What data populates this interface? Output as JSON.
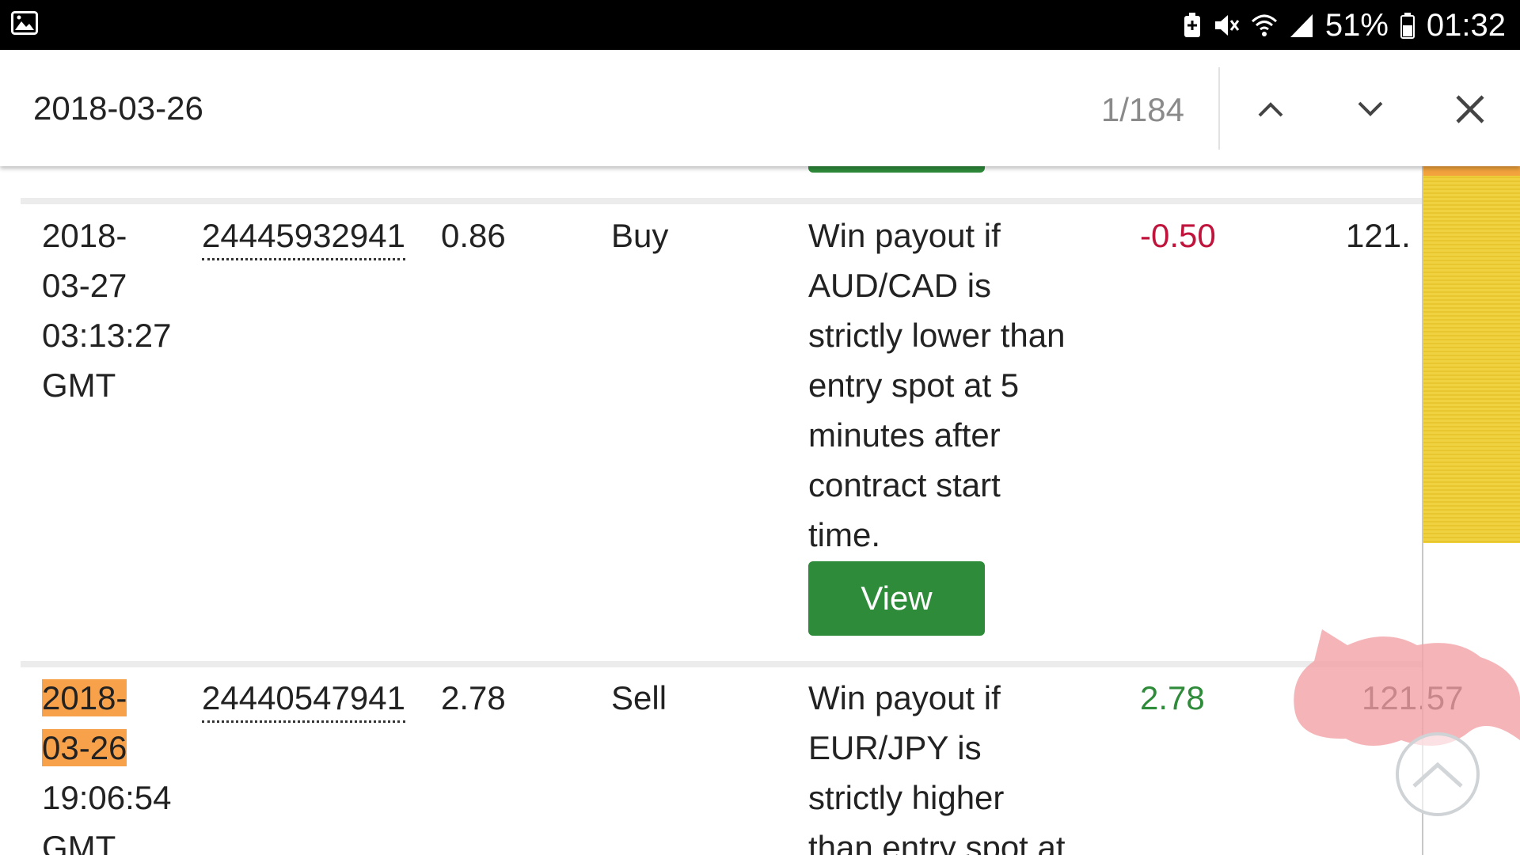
{
  "status_bar": {
    "battery_percent": "51%",
    "time": "01:32",
    "icons": [
      "gallery-icon",
      "battery-saver-icon",
      "mute-icon",
      "wifi-icon",
      "signal-icon",
      "battery-icon"
    ]
  },
  "find_bar": {
    "query": "2018-03-26",
    "match_count": "1/184",
    "prev_icon": "chevron-up-icon",
    "next_icon": "chevron-down-icon",
    "close_icon": "close-icon"
  },
  "rows": [
    {
      "date_lines": [
        "2018-",
        "03-27",
        "03:13:27",
        "GMT"
      ],
      "ref": "24445932941",
      "buy_price": "0.86",
      "type": "Buy",
      "description_lines": [
        "Win payout if",
        "AUD/CAD is",
        "strictly lower than",
        "entry spot at 5",
        "minutes after",
        "contract start",
        "time."
      ],
      "profit": "-0.50",
      "balance": "121.",
      "view_label": "View"
    },
    {
      "date_lines": [
        "2018-",
        "03-26",
        "19:06:54",
        "GMT"
      ],
      "ref": "24440547941",
      "buy_price": "2.78",
      "type": "Sell",
      "description_lines": [
        "Win payout if",
        "EUR/JPY is",
        "strictly higher",
        "than entry spot at"
      ],
      "profit": "2.78",
      "balance": "121.57"
    }
  ],
  "colors": {
    "view_button": "#2e8b3a",
    "negative": "#c0143c",
    "positive": "#2e8b3a",
    "highlight": "#f7a24a",
    "scroll_thumb": "#f0d240"
  }
}
